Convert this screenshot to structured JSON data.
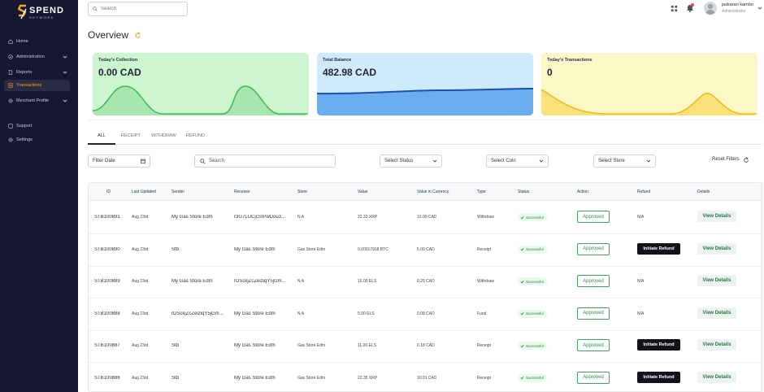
{
  "brand": {
    "name": "SPEND",
    "tag": "NETWORK",
    "accent": "#f5a623",
    "sidebar_bg": "#161833"
  },
  "sidebar": {
    "items": [
      {
        "label": "Home",
        "icon": "home-icon",
        "chevron": false,
        "active": false
      },
      {
        "label": "Administration",
        "icon": "shield-check-icon",
        "chevron": true,
        "active": false
      },
      {
        "label": "Reports",
        "icon": "doc-icon",
        "chevron": true,
        "active": false
      },
      {
        "label": "Transactions",
        "icon": "receipt-icon",
        "chevron": false,
        "active": true
      },
      {
        "label": "Merchant Profile",
        "icon": "gear-icon",
        "chevron": true,
        "active": false
      },
      {
        "label": "Support",
        "icon": "support-icon",
        "chevron": false,
        "active": false
      },
      {
        "label": "Settings",
        "icon": "gear-icon",
        "chevron": false,
        "active": false
      }
    ]
  },
  "header": {
    "search_placeholder": "Search",
    "user_name": "jaskaran kambo",
    "user_role": "Administrator"
  },
  "page": {
    "title": "Overview"
  },
  "cards": [
    {
      "label": "Today's Collection",
      "value": "0.00 CAD",
      "color": "#5fcf6f"
    },
    {
      "label": "Total Balance",
      "value": "482.98 CAD",
      "color": "#2b6fd6"
    },
    {
      "label": "Today's Transactions",
      "value": "0",
      "color": "#f2c918"
    }
  ],
  "tabs": [
    "ALL",
    "RECEIPT",
    "WITHDRAW",
    "REFUND"
  ],
  "filters": {
    "date": "Filter Date",
    "search_placeholder": "Search",
    "status": "Select Status",
    "coin": "Select Coin",
    "store": "Select Store",
    "reset": "Reset Filters"
  },
  "table": {
    "columns": [
      "ID",
      "Last Updated",
      "Sender",
      "Receiver",
      "Store",
      "Value",
      "Value in Currency",
      "Type",
      "Status",
      "Action",
      "Refund",
      "Details"
    ],
    "rows": [
      {
        "id": "STB100891",
        "updated": "Aug 23rd",
        "sender": "My Gas Store Edm",
        "receiver": "r3G7LUCjcStPwDou3...",
        "store": "N A",
        "value": "22.33 XRP",
        "currency": "10.00 CAD",
        "type": "Withdraw",
        "status": "Successful",
        "action": "Approved",
        "refund": "N/A",
        "details": "View Details"
      },
      {
        "id": "STB100890",
        "updated": "Aug 23rd",
        "sender": "Stb",
        "receiver": "My Gas Store Edm",
        "store": "Gas Store Edm",
        "value": "0.00017918 BTC",
        "currency": "5.00 CAD",
        "type": "Receipt",
        "status": "Successful",
        "action": "Approved",
        "refund": "Initiate Refund",
        "details": "View Details"
      },
      {
        "id": "STB100889",
        "updated": "Aug 23rd",
        "sender": "My Gas Store Edm",
        "receiver": "rDSckjZcZeiziqY5jGm...",
        "store": "N A",
        "value": "15.00 ELS",
        "currency": "0.25 CAD",
        "type": "Withdraw",
        "status": "Successful",
        "action": "Approved",
        "refund": "N/A",
        "details": "View Details"
      },
      {
        "id": "STB100888",
        "updated": "Aug 23rd",
        "sender": "rDSckjZcZeiziqY5jGm...",
        "receiver": "My Gas Store Edm",
        "store": "N A",
        "value": "5.00 ELS",
        "currency": "0.08 CAD",
        "type": "Fund",
        "status": "Successful",
        "action": "Approved",
        "refund": "N/A",
        "details": "View Details"
      },
      {
        "id": "STB100887",
        "updated": "Aug 23rd",
        "sender": "Stb",
        "receiver": "My Gas Store Edm",
        "store": "Gas Store Edm",
        "value": "11.00 ELS",
        "currency": "0.18 CAD",
        "type": "Receipt",
        "status": "Successful",
        "action": "Approved",
        "refund": "Initiate Refund",
        "details": "View Details"
      },
      {
        "id": "STB100886",
        "updated": "Aug 23rd",
        "sender": "Stb",
        "receiver": "My Gas Store Edm",
        "store": "Gas Store Edm",
        "value": "22.35 XRP",
        "currency": "10.01 CAD",
        "type": "Receipt",
        "status": "Successful",
        "action": "Approved",
        "refund": "Initiate Refund",
        "details": "View Details"
      }
    ]
  }
}
